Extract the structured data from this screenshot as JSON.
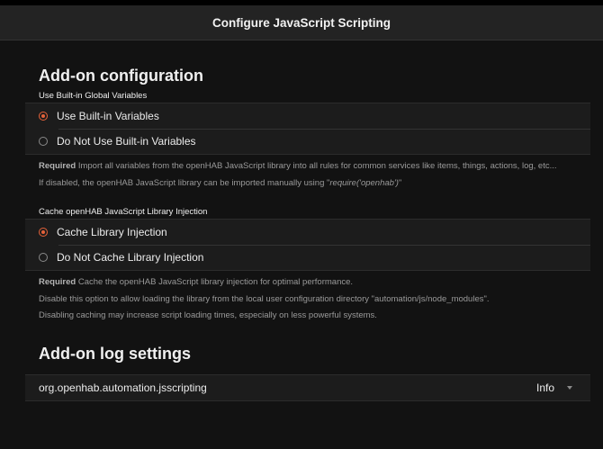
{
  "header": {
    "title": "Configure JavaScript Scripting"
  },
  "config": {
    "section_title": "Add-on configuration",
    "globals": {
      "label": "Use Built-in Global Variables",
      "options": [
        {
          "label": "Use Built-in Variables",
          "checked": true
        },
        {
          "label": "Do Not Use Built-in Variables",
          "checked": false
        }
      ],
      "required": "Required",
      "desc_line1": " Import all variables from the openHAB JavaScript library into all rules for common services like items, things, actions, log, etc...",
      "desc_line2_prefix": "If disabled, the openHAB JavaScript library can be imported manually using \"",
      "desc_line2_code": "require('openhab')",
      "desc_line2_suffix": "\""
    },
    "cache": {
      "label": "Cache openHAB JavaScript Library Injection",
      "options": [
        {
          "label": "Cache Library Injection",
          "checked": true
        },
        {
          "label": "Do Not Cache Library Injection",
          "checked": false
        }
      ],
      "required": "Required",
      "desc_line1": " Cache the openHAB JavaScript library injection for optimal performance.",
      "desc_line2": "Disable this option to allow loading the library from the local user configuration directory \"automation/js/node_modules\".",
      "desc_line3": "Disabling caching may increase script loading times, especially on less powerful systems."
    }
  },
  "log": {
    "section_title": "Add-on log settings",
    "logger": "org.openhab.automation.jsscripting",
    "level": "Info"
  },
  "colors": {
    "accent": "#e5623a",
    "background": "#121212"
  }
}
